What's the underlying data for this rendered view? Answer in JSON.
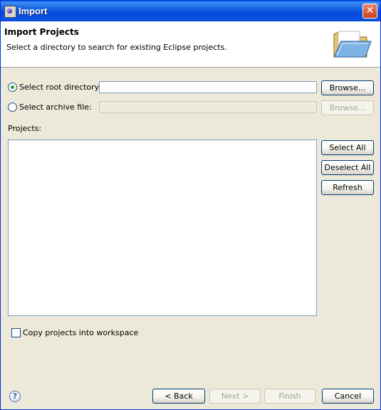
{
  "window": {
    "title": "Import",
    "close_label": "✕"
  },
  "banner": {
    "title": "Import Projects",
    "description": "Select a directory to search for existing Eclipse projects."
  },
  "form": {
    "root_dir_label": "Select root directory:",
    "root_dir_value": "",
    "root_dir_selected": true,
    "archive_label": "Select archive file:",
    "archive_value": "",
    "archive_selected": false,
    "browse_root_label": "Browse...",
    "browse_archive_label": "Browse...",
    "projects_label": "Projects:",
    "copy_label": "Copy projects into workspace",
    "copy_checked": false
  },
  "side_buttons": {
    "select_all": "Select All",
    "deselect_all": "Deselect All",
    "refresh": "Refresh"
  },
  "footer": {
    "help_glyph": "?",
    "back": "< Back",
    "next": "Next >",
    "finish": "Finish",
    "cancel": "Cancel"
  }
}
